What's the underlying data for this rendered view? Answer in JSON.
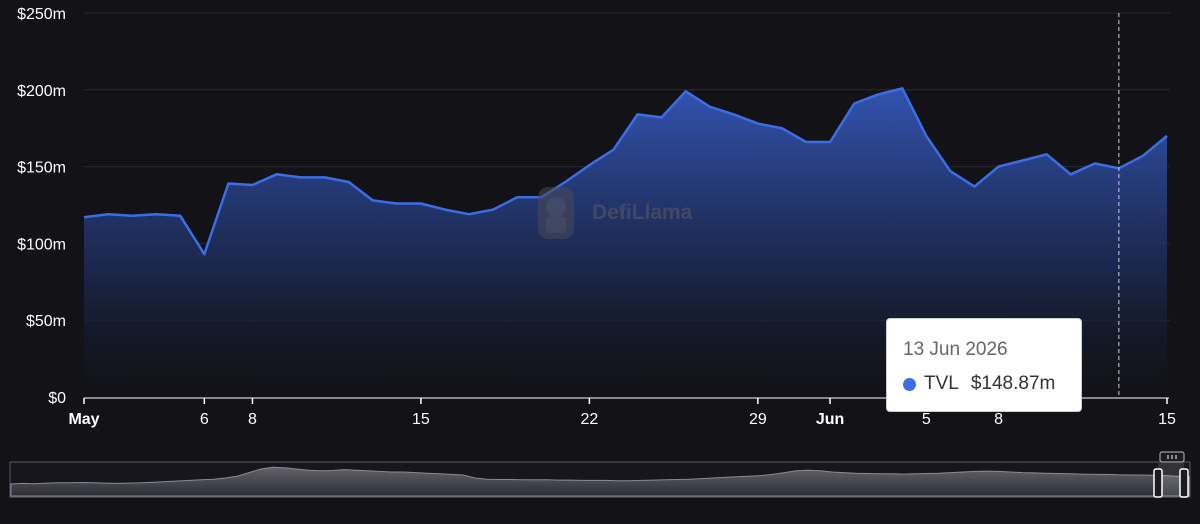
{
  "watermark": {
    "text": "DefiLlama"
  },
  "tooltip": {
    "date": "13 Jun 2026",
    "series": "TVL",
    "value": "$148.87m"
  },
  "colors": {
    "line": "#3b6ee6",
    "background": "#121217",
    "tooltip_dot": "#3b6ee6"
  },
  "chart_data": {
    "type": "area",
    "title": "",
    "xlabel": "",
    "ylabel": "",
    "ylim": [
      0,
      250
    ],
    "y_ticks": [
      "$0",
      "$50m",
      "$100m",
      "$150m",
      "$200m",
      "$250m"
    ],
    "x_ticks": [
      {
        "day": 0,
        "label": "May",
        "bold": true
      },
      {
        "day": 5,
        "label": "6"
      },
      {
        "day": 7,
        "label": "8"
      },
      {
        "day": 14,
        "label": "15"
      },
      {
        "day": 21,
        "label": "22"
      },
      {
        "day": 28,
        "label": "29"
      },
      {
        "day": 31,
        "label": "Jun",
        "bold": true
      },
      {
        "day": 35,
        "label": "5"
      },
      {
        "day": 38,
        "label": "8"
      },
      {
        "day": 45,
        "label": "15"
      }
    ],
    "hover_day": 43,
    "series": [
      {
        "name": "TVL",
        "x": [
          "2026-05-01",
          "2026-05-02",
          "2026-05-03",
          "2026-05-04",
          "2026-05-05",
          "2026-05-06",
          "2026-05-07",
          "2026-05-08",
          "2026-05-09",
          "2026-05-10",
          "2026-05-11",
          "2026-05-12",
          "2026-05-13",
          "2026-05-14",
          "2026-05-15",
          "2026-05-16",
          "2026-05-17",
          "2026-05-18",
          "2026-05-19",
          "2026-05-20",
          "2026-05-21",
          "2026-05-22",
          "2026-05-23",
          "2026-05-24",
          "2026-05-25",
          "2026-05-26",
          "2026-05-27",
          "2026-05-28",
          "2026-05-29",
          "2026-05-30",
          "2026-05-31",
          "2026-06-01",
          "2026-06-02",
          "2026-06-03",
          "2026-06-04",
          "2026-06-05",
          "2026-06-06",
          "2026-06-07",
          "2026-06-08",
          "2026-06-09",
          "2026-06-10",
          "2026-06-11",
          "2026-06-12",
          "2026-06-13",
          "2026-06-14",
          "2026-06-15"
        ],
        "values": [
          117,
          119,
          118,
          119,
          118,
          93,
          139,
          138,
          145,
          143,
          143,
          140,
          128,
          126,
          126,
          122,
          119,
          122,
          130,
          130,
          140,
          151,
          161,
          184,
          182,
          199,
          189,
          184,
          178,
          175,
          166,
          166,
          191,
          197,
          201,
          170,
          147,
          137,
          150,
          154,
          158,
          145,
          152,
          148.87,
          157,
          170
        ]
      }
    ]
  },
  "navigator": {
    "values": [
      40,
      42,
      41,
      43,
      44,
      44,
      45,
      44,
      43,
      42,
      43,
      44,
      46,
      48,
      50,
      52,
      54,
      56,
      60,
      66,
      78,
      90,
      96,
      94,
      90,
      86,
      84,
      85,
      88,
      86,
      84,
      82,
      80,
      80,
      78,
      76,
      74,
      72,
      70,
      60,
      56,
      55,
      55,
      54,
      54,
      54,
      53,
      53,
      52,
      52,
      52,
      51,
      51,
      52,
      53,
      54,
      55,
      56,
      58,
      60,
      62,
      64,
      66,
      68,
      72,
      78,
      84,
      86,
      84,
      80,
      78,
      76,
      75,
      74,
      74,
      73,
      74,
      75,
      76,
      78,
      80,
      82,
      83,
      82,
      80,
      78,
      77,
      76,
      75,
      74,
      73,
      72,
      72,
      71,
      70,
      70,
      69,
      68,
      66,
      64
    ]
  }
}
